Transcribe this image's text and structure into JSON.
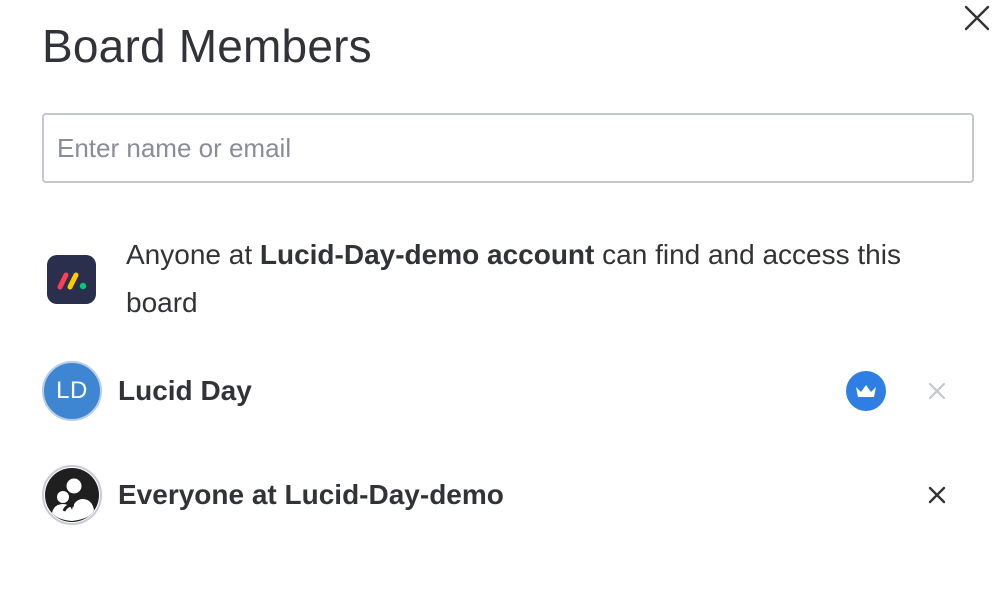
{
  "dialog": {
    "title": "Board Members",
    "close_icon": "close-icon"
  },
  "search": {
    "placeholder": "Enter name or email",
    "value": ""
  },
  "account_access": {
    "icon": "monday-logo-icon",
    "prefix": "Anyone at ",
    "account_name": "Lucid-Day-demo account",
    "suffix": " can find and access this board"
  },
  "members": [
    {
      "initials": "LD",
      "name": "Lucid Day",
      "avatar_color": "#3f86d2",
      "is_owner": true,
      "owner_icon": "crown-icon",
      "remove_icon": "close-icon",
      "remove_enabled": false
    },
    {
      "name": "Everyone at Lucid-Day-demo",
      "avatar_icon": "team-icon",
      "is_owner": false,
      "remove_icon": "close-icon",
      "remove_enabled": true
    }
  ],
  "colors": {
    "owner_badge": "#2f7ee3",
    "logo_bg": "#292f4c",
    "text": "#323338",
    "disabled_icon": "#c5c7d0"
  }
}
